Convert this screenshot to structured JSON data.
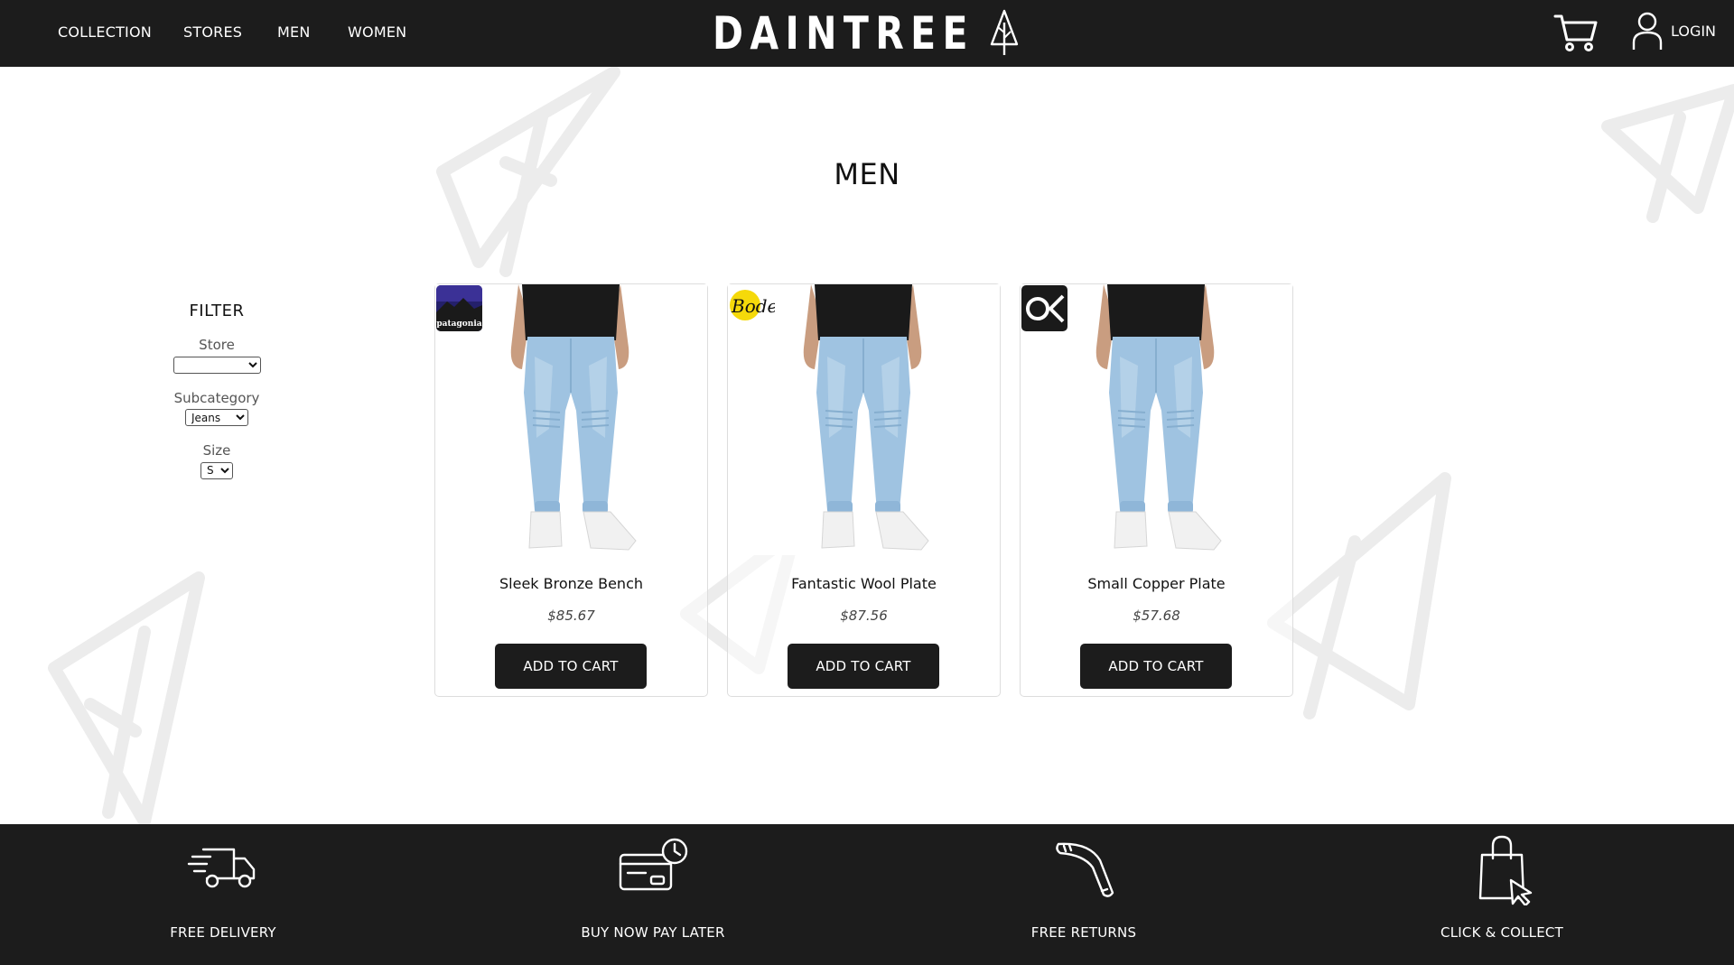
{
  "header": {
    "nav": [
      "COLLECTION",
      "STORES",
      "MEN",
      "WOMEN"
    ],
    "brand": "DAINTREE",
    "login_label": "LOGIN",
    "cart_icon": "shopping-cart-icon",
    "user_icon": "user-icon"
  },
  "page": {
    "title": "MEN"
  },
  "filter": {
    "title": "FILTER",
    "store_label": "Store",
    "store_value": "",
    "subcategory_label": "Subcategory",
    "subcategory_value": "Jeans",
    "size_label": "Size",
    "size_value": "S"
  },
  "products": [
    {
      "name": "Sleek Bronze Bench",
      "price": "$85.67",
      "brand_logo": "patagonia",
      "button": "ADD TO CART"
    },
    {
      "name": "Fantastic Wool Plate",
      "price": "$87.56",
      "brand_logo": "Boden",
      "button": "ADD TO CART"
    },
    {
      "name": "Small Copper Plate",
      "price": "$57.68",
      "brand_logo": "OK",
      "button": "ADD TO CART"
    }
  ],
  "footer": {
    "perks": [
      {
        "label": "FREE DELIVERY",
        "icon": "delivery-truck-icon"
      },
      {
        "label": "BUY NOW PAY LATER",
        "icon": "credit-card-clock-icon"
      },
      {
        "label": "FREE RETURNS",
        "icon": "boomerang-icon"
      },
      {
        "label": "CLICK & COLLECT",
        "icon": "shopping-bag-cursor-icon"
      }
    ]
  },
  "colors": {
    "header_bg": "#1c1c1c",
    "button_bg": "#1c1c1c",
    "text": "#111111",
    "card_border": "#dddddd"
  }
}
